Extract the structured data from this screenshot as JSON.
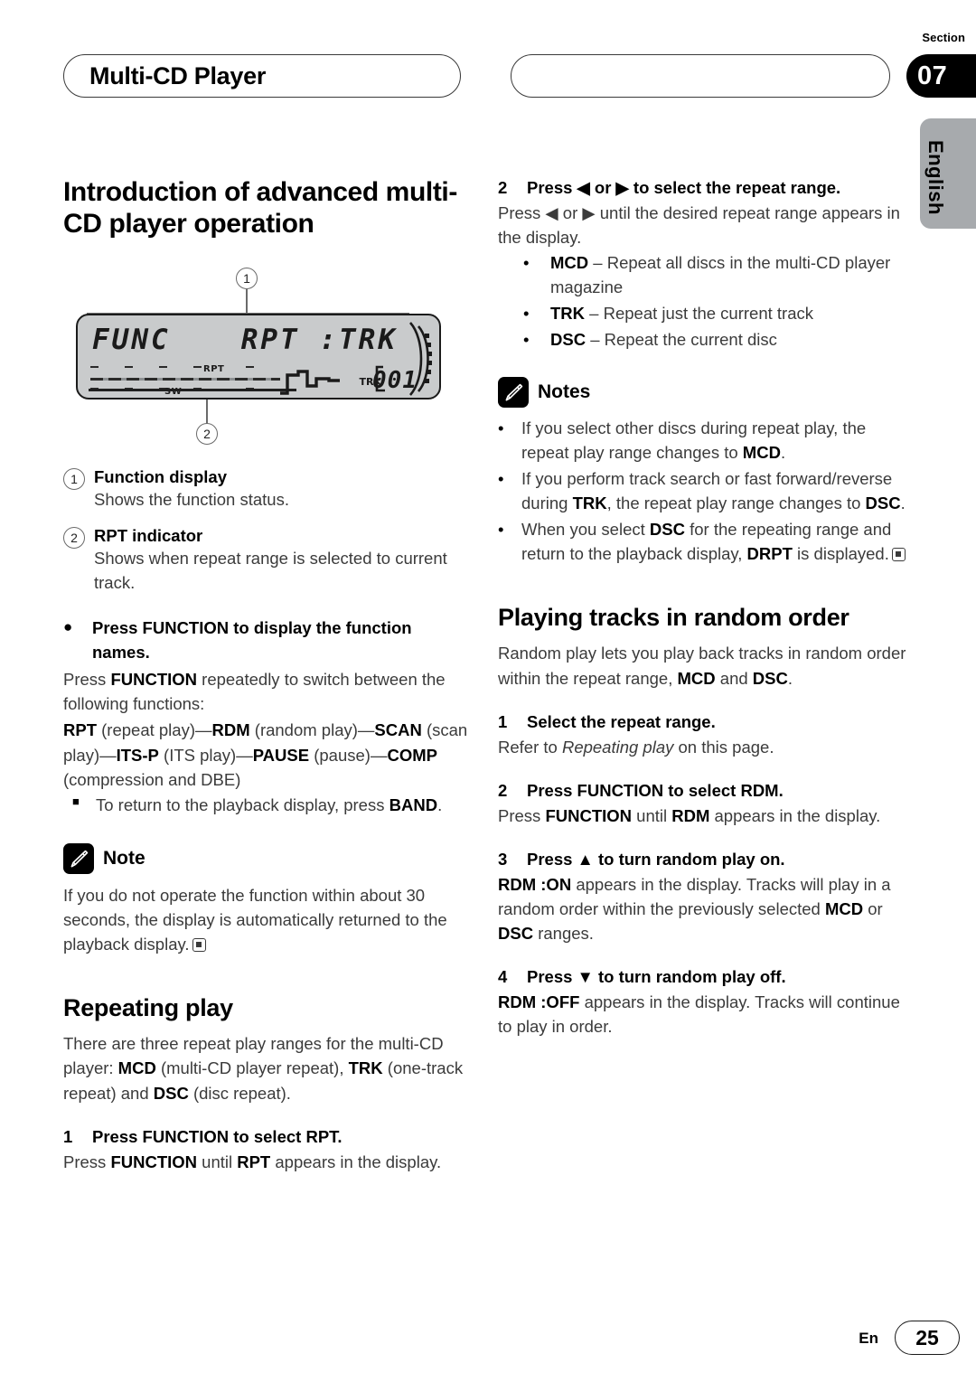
{
  "header": {
    "chapter_title": "Multi-CD Player",
    "second_pill_title": "",
    "section_label": "Section",
    "section_number": "07",
    "language_tab": "English"
  },
  "left_column": {
    "title": "Introduction of advanced multi-CD player operation",
    "figure": {
      "display_left_text": "FUNC",
      "display_right_text": "RPT :TRK",
      "indicator_rpt": "RPT",
      "indicator_sw": "SW",
      "track_tag": "TRK",
      "track_number": "001",
      "callout_1": "1",
      "callout_2": "2"
    },
    "callouts": [
      {
        "num": "1",
        "title": "Function display",
        "desc": "Shows the function status."
      },
      {
        "num": "2",
        "title": "RPT indicator",
        "desc": "Shows when repeat range is selected to current track."
      }
    ],
    "function_bullet": {
      "marker": "●",
      "heading": "Press FUNCTION to display the function names.",
      "body_line1_a": "Press ",
      "body_line1_b": "FUNCTION",
      "body_line1_c": " repeatedly to switch between the following functions:",
      "chain": [
        {
          "bold": "RPT",
          "plain": " (repeat play)—"
        },
        {
          "bold": "RDM",
          "plain": " (random play)—"
        },
        {
          "bold": "SCAN",
          "plain": " (scan play)—"
        },
        {
          "bold": "ITS-P",
          "plain": " (ITS play)—"
        },
        {
          "bold": "PAUSE",
          "plain": " (pause)—"
        },
        {
          "bold": "COMP",
          "plain": " (compression and DBE)"
        }
      ],
      "sub_marker": "■",
      "sub_text_a": "To return to the playback display, press ",
      "sub_text_b": "BAND",
      "sub_text_c": "."
    },
    "note": {
      "icon": "pencil-icon",
      "label": "Note",
      "text": "If you do not operate the function within about 30 seconds, the display is automatically returned to the playback display."
    },
    "repeating_play": {
      "title": "Repeating play",
      "intro_a": "There are three repeat play ranges for the multi-CD player: ",
      "intro_mcd": "MCD",
      "intro_b": " (multi-CD player repeat), ",
      "intro_trk": "TRK",
      "intro_c": " (one-track repeat) and ",
      "intro_dsc": "DSC",
      "intro_d": " (disc repeat).",
      "step1_num": "1",
      "step1_head": "Press FUNCTION to select RPT.",
      "step1_a": "Press ",
      "step1_b": "FUNCTION",
      "step1_c": " until ",
      "step1_d": "RPT",
      "step1_e": " appears in the display."
    }
  },
  "right_column": {
    "step2_num": "2",
    "step2_head": "Press ◀ or ▶ to select the repeat range.",
    "step2_a": "Press ◀ or ▶ until the desired repeat range appears in the display.",
    "step2_bullets": [
      {
        "marker": "•",
        "bold": "MCD",
        "text": " – Repeat all discs in the multi-CD player magazine"
      },
      {
        "marker": "•",
        "bold": "TRK",
        "text": " – Repeat just the current track"
      },
      {
        "marker": "•",
        "bold": "DSC",
        "text": " – Repeat the current disc"
      }
    ],
    "notes": {
      "icon": "pencil-icon",
      "label": "Notes",
      "items": [
        {
          "marker": "•",
          "a": "If you select other discs during repeat play, the repeat play range changes to ",
          "b": "MCD",
          "c": "."
        },
        {
          "marker": "•",
          "a": "If you perform track search or fast forward/reverse during ",
          "b": "TRK",
          "c": ", the repeat play range changes to ",
          "d": "DSC",
          "e": "."
        },
        {
          "marker": "•",
          "a": "When you select ",
          "b": "DSC",
          "c": " for the repeating range and return to the playback display, ",
          "d": "DRPT",
          "e": " is displayed."
        }
      ]
    },
    "random_order": {
      "title": "Playing tracks in random order",
      "intro_a": "Random play lets you play back tracks in random order within the repeat range, ",
      "intro_mcd": "MCD",
      "intro_b": " and ",
      "intro_dsc": "DSC",
      "intro_c": ".",
      "steps": [
        {
          "num": "1",
          "head": "Select the repeat range.",
          "body_a": "Refer to ",
          "body_italic": "Repeating play",
          "body_b": " on this page."
        },
        {
          "num": "2",
          "head": "Press FUNCTION to select RDM.",
          "body_a": "Press ",
          "body_bold1": "FUNCTION",
          "body_b": " until ",
          "body_bold2": "RDM",
          "body_c": " appears in the display."
        },
        {
          "num": "3",
          "head": "Press ▲ to turn random play on.",
          "body_bold1": "RDM :ON",
          "body_a": " appears in the display. Tracks will play in a random order within the previously selected ",
          "body_bold2": "MCD",
          "body_b": " or ",
          "body_bold3": "DSC",
          "body_c": " ranges."
        },
        {
          "num": "4",
          "head": "Press ▼ to turn random play off.",
          "body_bold1": "RDM :OFF",
          "body_a": " appears in the display. Tracks will continue to play in order."
        }
      ]
    }
  },
  "footer": {
    "language": "En",
    "page_number": "25"
  }
}
